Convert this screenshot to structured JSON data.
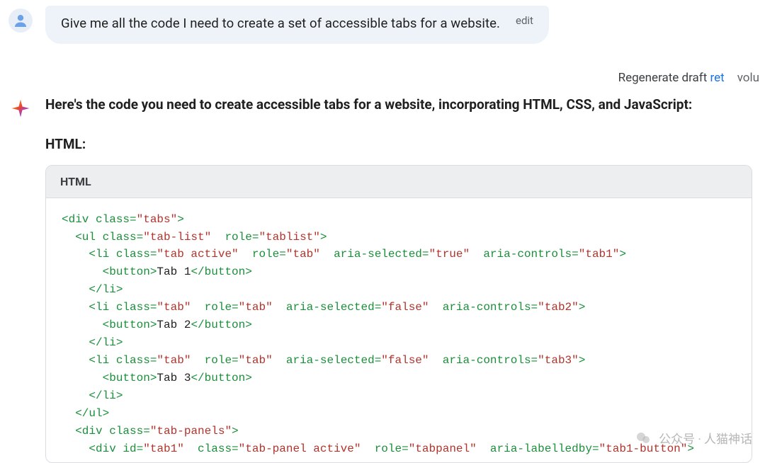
{
  "user": {
    "prompt": "Give me all the code I need to create a set of accessible tabs for a website.",
    "edit_label": "edit"
  },
  "toolbar": {
    "regenerate_label": "Regenerate draft",
    "regenerate_suffix": "ret",
    "volume_fragment": "volu"
  },
  "ai": {
    "intro": "Here's the code you need to create accessible tabs for a website, incorporating HTML, CSS, and JavaScript:",
    "html_heading": "HTML:",
    "code_block_label": "HTML",
    "code_lines": [
      [
        [
          "key",
          "<div "
        ],
        [
          "key",
          "class="
        ],
        [
          "str",
          "\"tabs\""
        ],
        [
          "key",
          ">"
        ]
      ],
      [
        [
          "txt",
          "  "
        ],
        [
          "key",
          "<ul "
        ],
        [
          "key",
          "class="
        ],
        [
          "str",
          "\"tab-list\""
        ],
        [
          "txt",
          "  "
        ],
        [
          "key",
          "role="
        ],
        [
          "str",
          "\"tablist\""
        ],
        [
          "key",
          ">"
        ]
      ],
      [
        [
          "txt",
          "    "
        ],
        [
          "key",
          "<li "
        ],
        [
          "key",
          "class="
        ],
        [
          "str",
          "\"tab active\""
        ],
        [
          "txt",
          "  "
        ],
        [
          "key",
          "role="
        ],
        [
          "str",
          "\"tab\""
        ],
        [
          "txt",
          "  "
        ],
        [
          "key",
          "aria-selected="
        ],
        [
          "str",
          "\"true\""
        ],
        [
          "txt",
          "  "
        ],
        [
          "key",
          "aria-controls="
        ],
        [
          "str",
          "\"tab1\""
        ],
        [
          "key",
          ">"
        ]
      ],
      [
        [
          "txt",
          "      "
        ],
        [
          "key",
          "<button>"
        ],
        [
          "txt",
          "Tab 1"
        ],
        [
          "key",
          "</button>"
        ]
      ],
      [
        [
          "txt",
          "    "
        ],
        [
          "key",
          "</li>"
        ]
      ],
      [
        [
          "txt",
          "    "
        ],
        [
          "key",
          "<li "
        ],
        [
          "key",
          "class="
        ],
        [
          "str",
          "\"tab\""
        ],
        [
          "txt",
          "  "
        ],
        [
          "key",
          "role="
        ],
        [
          "str",
          "\"tab\""
        ],
        [
          "txt",
          "  "
        ],
        [
          "key",
          "aria-selected="
        ],
        [
          "str",
          "\"false\""
        ],
        [
          "txt",
          "  "
        ],
        [
          "key",
          "aria-controls="
        ],
        [
          "str",
          "\"tab2\""
        ],
        [
          "key",
          ">"
        ]
      ],
      [
        [
          "txt",
          "      "
        ],
        [
          "key",
          "<button>"
        ],
        [
          "txt",
          "Tab 2"
        ],
        [
          "key",
          "</button>"
        ]
      ],
      [
        [
          "txt",
          "    "
        ],
        [
          "key",
          "</li>"
        ]
      ],
      [
        [
          "txt",
          "    "
        ],
        [
          "key",
          "<li "
        ],
        [
          "key",
          "class="
        ],
        [
          "str",
          "\"tab\""
        ],
        [
          "txt",
          "  "
        ],
        [
          "key",
          "role="
        ],
        [
          "str",
          "\"tab\""
        ],
        [
          "txt",
          "  "
        ],
        [
          "key",
          "aria-selected="
        ],
        [
          "str",
          "\"false\""
        ],
        [
          "txt",
          "  "
        ],
        [
          "key",
          "aria-controls="
        ],
        [
          "str",
          "\"tab3\""
        ],
        [
          "key",
          ">"
        ]
      ],
      [
        [
          "txt",
          "      "
        ],
        [
          "key",
          "<button>"
        ],
        [
          "txt",
          "Tab 3"
        ],
        [
          "key",
          "</button>"
        ]
      ],
      [
        [
          "txt",
          "    "
        ],
        [
          "key",
          "</li>"
        ]
      ],
      [
        [
          "txt",
          "  "
        ],
        [
          "key",
          "</ul>"
        ]
      ],
      [
        [
          "txt",
          "  "
        ],
        [
          "key",
          "<div "
        ],
        [
          "key",
          "class="
        ],
        [
          "str",
          "\"tab-panels\""
        ],
        [
          "key",
          ">"
        ]
      ],
      [
        [
          "txt",
          "    "
        ],
        [
          "key",
          "<div "
        ],
        [
          "key",
          "id="
        ],
        [
          "str",
          "\"tab1\""
        ],
        [
          "txt",
          "  "
        ],
        [
          "key",
          "class="
        ],
        [
          "str",
          "\"tab-panel active\""
        ],
        [
          "txt",
          "  "
        ],
        [
          "key",
          "role="
        ],
        [
          "str",
          "\"tabpanel\""
        ],
        [
          "txt",
          "  "
        ],
        [
          "key",
          "aria-labelledby="
        ],
        [
          "str",
          "\"tab1-button\""
        ],
        [
          "key",
          ">"
        ]
      ]
    ]
  },
  "watermark": {
    "text": "公众号 · 人猫神话"
  }
}
